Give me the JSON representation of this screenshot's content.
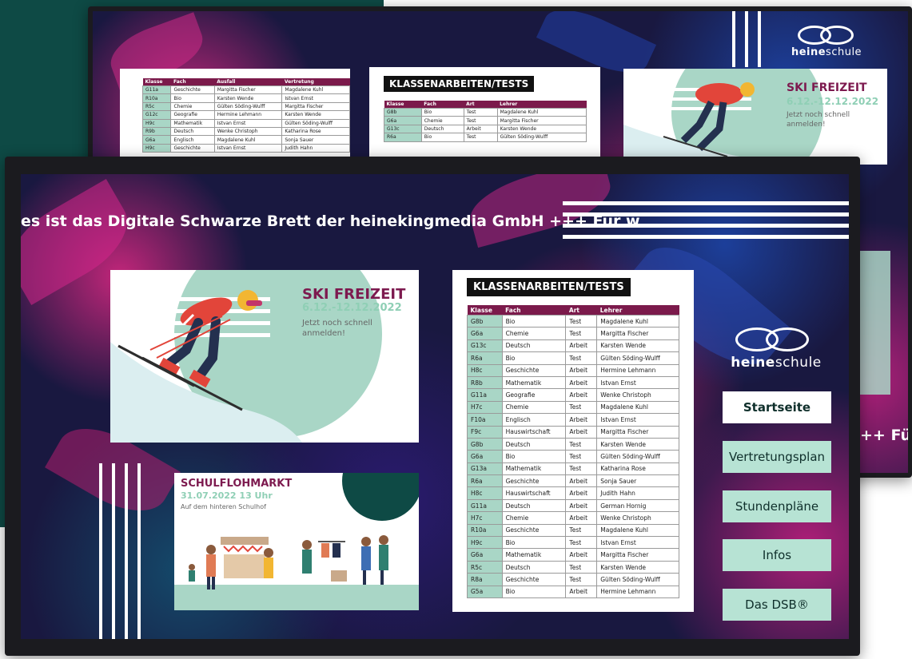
{
  "ticker": "es ist das Digitale Schwarze Brett der heinekingmedia GmbH +++ Für w",
  "ticker_back": "++ Für",
  "logo": {
    "brand_bold": "heine",
    "brand_light": "schule"
  },
  "ski": {
    "title": "SKI FREIZEIT",
    "date": "6.12.-12.12.2022",
    "sub_line1": "Jetzt noch schnell",
    "sub_line2": "anmelden!"
  },
  "flohmarkt": {
    "title": "SCHULFLOHMARKT",
    "date": "31.07.2022  13 Uhr",
    "sub": "Auf dem hinteren Schulhof"
  },
  "tests": {
    "title": "KLASSENARBEITEN/TESTS",
    "headers": [
      "Klasse",
      "Fach",
      "Art",
      "Lehrer"
    ],
    "rows": [
      [
        "G8b",
        "Bio",
        "Test",
        "Magdalene Kuhl"
      ],
      [
        "G6a",
        "Chemie",
        "Test",
        "Margitta Fischer"
      ],
      [
        "G13c",
        "Deutsch",
        "Arbeit",
        "Karsten Wende"
      ],
      [
        "R6a",
        "Bio",
        "Test",
        "Gülten Söding-Wulff"
      ],
      [
        "H8c",
        "Geschichte",
        "Arbeit",
        "Hermine Lehmann"
      ],
      [
        "R8b",
        "Mathematik",
        "Arbeit",
        "Istvan Ernst"
      ],
      [
        "G11a",
        "Geografie",
        "Arbeit",
        "Wenke Christoph"
      ],
      [
        "H7c",
        "Chemie",
        "Test",
        "Magdalene Kuhl"
      ],
      [
        "F10a",
        "Englisch",
        "Arbeit",
        "Istvan Ernst"
      ],
      [
        "F9c",
        "Hauswirtschaft",
        "Arbeit",
        "Margitta Fischer"
      ],
      [
        "G8b",
        "Deutsch",
        "Test",
        "Karsten Wende"
      ],
      [
        "G6a",
        "Bio",
        "Test",
        "Gülten Söding-Wulff"
      ],
      [
        "G13a",
        "Mathematik",
        "Test",
        "Katharina Rose"
      ],
      [
        "R6a",
        "Geschichte",
        "Arbeit",
        "Sonja Sauer"
      ],
      [
        "H8c",
        "Hauswirtschaft",
        "Arbeit",
        "Judith Hahn"
      ],
      [
        "G11a",
        "Deutsch",
        "Arbeit",
        "German Hornig"
      ],
      [
        "H7c",
        "Chemie",
        "Arbeit",
        "Wenke Christoph"
      ],
      [
        "R10a",
        "Geschichte",
        "Test",
        "Magdalene Kuhl"
      ],
      [
        "H9c",
        "Bio",
        "Test",
        "Istvan Ernst"
      ],
      [
        "G6a",
        "Mathematik",
        "Arbeit",
        "Margitta Fischer"
      ],
      [
        "R5c",
        "Deutsch",
        "Test",
        "Karsten Wende"
      ],
      [
        "R8a",
        "Geschichte",
        "Test",
        "Gülten Söding-Wulff"
      ],
      [
        "G5a",
        "Bio",
        "Arbeit",
        "Hermine Lehmann"
      ]
    ]
  },
  "tests_back": {
    "title": "KLASSENARBEITEN/TESTS",
    "headers": [
      "Klasse",
      "Fach",
      "Art",
      "Lehrer"
    ],
    "rows": [
      [
        "G8b",
        "Bio",
        "Test",
        "Magdalene Kuhl"
      ],
      [
        "G6a",
        "Chemie",
        "Test",
        "Margitta Fischer"
      ],
      [
        "G13c",
        "Deutsch",
        "Arbeit",
        "Karsten Wende"
      ],
      [
        "R6a",
        "Bio",
        "Test",
        "Gülten Söding-Wulff"
      ]
    ]
  },
  "vertretung": {
    "headers": [
      "Klasse",
      "Fach",
      "Ausfall",
      "Vertretung"
    ],
    "rows": [
      [
        "G11a",
        "Geschichte",
        "Margitta Fischer",
        "Magdalene Kuhl"
      ],
      [
        "R10a",
        "Bio",
        "Karsten Wende",
        "Istvan Ernst"
      ],
      [
        "R5c",
        "Chemie",
        "Gülten Söding-Wulff",
        "Margitta Fischer"
      ],
      [
        "G12c",
        "Geografie",
        "Hermine Lehmann",
        "Karsten Wende"
      ],
      [
        "H9c",
        "Mathematik",
        "Istvan Ernst",
        "Gülten Söding-Wulff"
      ],
      [
        "R9b",
        "Deutsch",
        "Wenke Christoph",
        "Katharina Rose"
      ],
      [
        "G6a",
        "Englisch",
        "Magdalene Kuhl",
        "Sonja Sauer"
      ],
      [
        "H9c",
        "Geschichte",
        "Istvan Ernst",
        "Judith Hahn"
      ]
    ]
  },
  "nav": [
    {
      "label": "Startseite",
      "active": true
    },
    {
      "label": "Vertretungsplan",
      "active": false
    },
    {
      "label": "Stundenpläne",
      "active": false
    },
    {
      "label": "Infos",
      "active": false
    },
    {
      "label": "Das DSB®",
      "active": false
    }
  ],
  "colors": {
    "accent_plum": "#7b1a4b",
    "mint": "#a9d6c6",
    "teal_dark": "#0e4a45"
  }
}
